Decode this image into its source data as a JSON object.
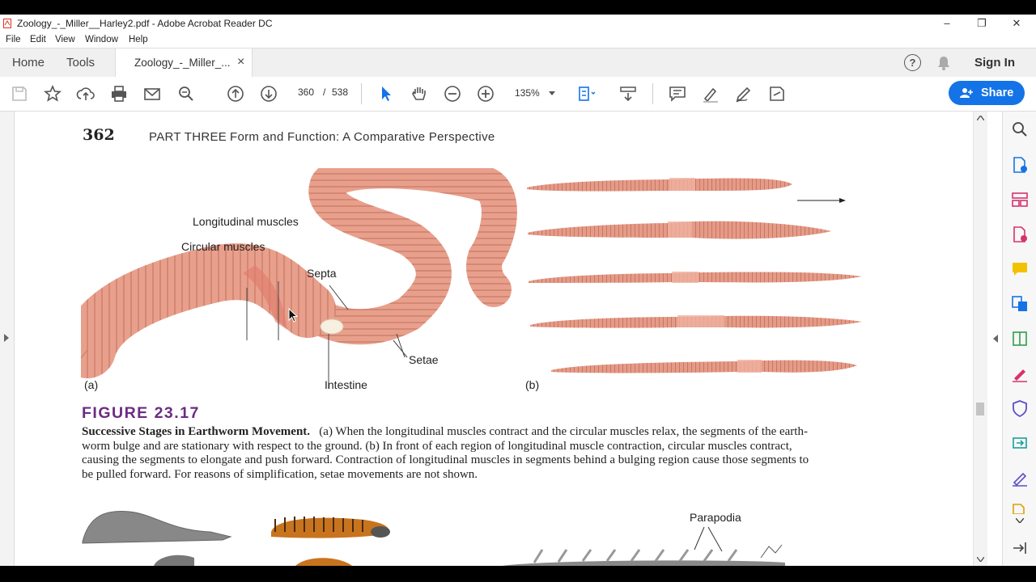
{
  "window": {
    "title": "Zoology_-_Miller__Harley2.pdf - Adobe Acrobat Reader DC",
    "min": "–",
    "restore": "❐",
    "close": "✕"
  },
  "menu": [
    "File",
    "Edit",
    "View",
    "Window",
    "Help"
  ],
  "tabs": {
    "home": "Home",
    "tools": "Tools",
    "document": "Zoology_-_Miller_...",
    "close": "×"
  },
  "header_right": {
    "help": "?",
    "signin": "Sign In",
    "share": "Share"
  },
  "toolbar": {
    "page_current": "360",
    "page_sep": "/",
    "page_total": "538",
    "zoom": "135%"
  },
  "page": {
    "number": "362",
    "running_head": "PART THREE",
    "running_title": "Form and Function: A Comparative Perspective",
    "labels": {
      "longitudinal": "Longitudinal muscles",
      "circular": "Circular muscles",
      "septa": "Septa",
      "setae": "Setae",
      "intestine": "Intestine",
      "a": "(a)",
      "b": "(b)",
      "parapodia": "Parapodia"
    },
    "figure_title": "FIGURE 23.17",
    "caption_bold": "Successive Stages in Earthworm Movement.",
    "caption_line1": "(a) When the longitudinal muscles contract and the circular muscles relax, the segments of the earth-",
    "caption_line2": "worm bulge and are stationary with respect to the ground. (b) In front of each region of longitudinal muscle contraction, circular muscles contract,",
    "caption_line3": "causing the segments to elongate and push forward. Contraction of longitudinal muscles in segments behind a bulging region cause those segments to",
    "caption_line4": "be pulled forward. For reasons of simplification, setae movements are not shown."
  },
  "colors": {
    "accent_blue": "#1473e6",
    "figure_purple": "#6b2c82",
    "worm": "#e29580",
    "worm_dark": "#c9705c"
  }
}
